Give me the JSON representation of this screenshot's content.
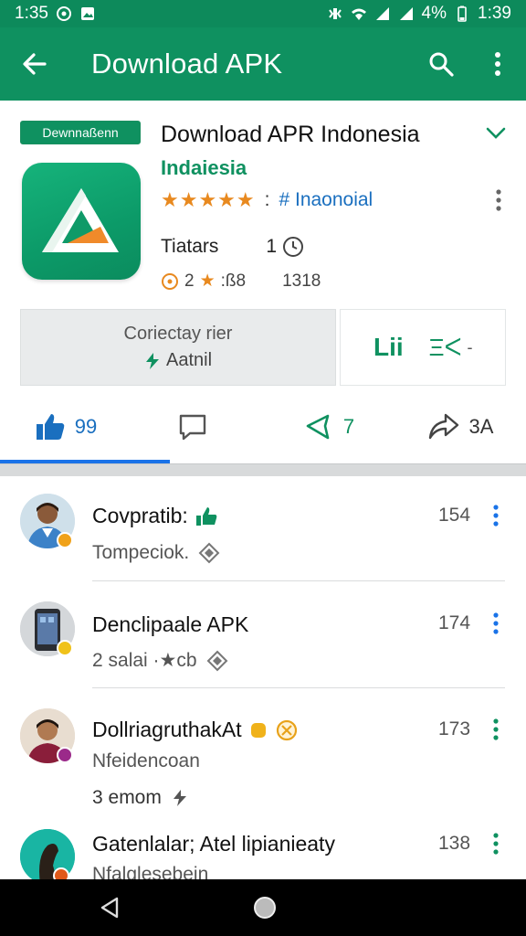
{
  "status_bar": {
    "time_left": "1:35",
    "battery": "4%",
    "time_right": "1:39"
  },
  "app_bar": {
    "title": "Download APK",
    "back_icon": "arrow-back-icon",
    "search_icon": "search-icon",
    "menu_icon": "more-vert-icon"
  },
  "app": {
    "badge": "Dewnnaßenn",
    "title": "Download APR Indonesia",
    "subtitle": "Indaiesia",
    "stars": "★★★★★",
    "rating_sep": ":",
    "category": "# Inaonoial",
    "meta_label": "Tiatars",
    "meta_value": "1",
    "meta2_a": "2",
    "meta2_b": ":ß8",
    "meta2_c": "1318",
    "action_line1": "Coriectay rier",
    "action_line2": "Aatnil",
    "right_label1": "Lii",
    "right_label2": "Ξᐸ",
    "right_label3": "-",
    "stats": [
      {
        "icon": "thumbs-up-icon",
        "value": "99"
      },
      {
        "icon": "comment-icon",
        "value": ""
      },
      {
        "icon": "megaphone-icon",
        "value": "7"
      },
      {
        "icon": "share-icon",
        "value": "3A"
      }
    ]
  },
  "list": [
    {
      "title": "Covpratib:",
      "sub": "Tompeciok.",
      "count": "154",
      "extra": "",
      "kebab_color": "#1a73e8"
    },
    {
      "title": "Denclipaale APK",
      "sub": "2 salai ·★cb",
      "count": "174",
      "extra": "",
      "kebab_color": "#1a73e8"
    },
    {
      "title": "DollriagruthakAt",
      "sub": "Nfeidencoan",
      "sub2": "3 emom",
      "count": "173",
      "extra": "",
      "kebab_color": "#0f9160"
    },
    {
      "title": "Gatenlalar; Atel lipianieaty",
      "sub": "Nfalglesebein",
      "count": "138",
      "extra": "",
      "kebab_color": "#0f9160"
    }
  ],
  "colors": {
    "brand_green": "#0f9160",
    "status_green": "#0d8a5b",
    "link_blue": "#1a6fbf",
    "star_orange": "#e8891f"
  }
}
